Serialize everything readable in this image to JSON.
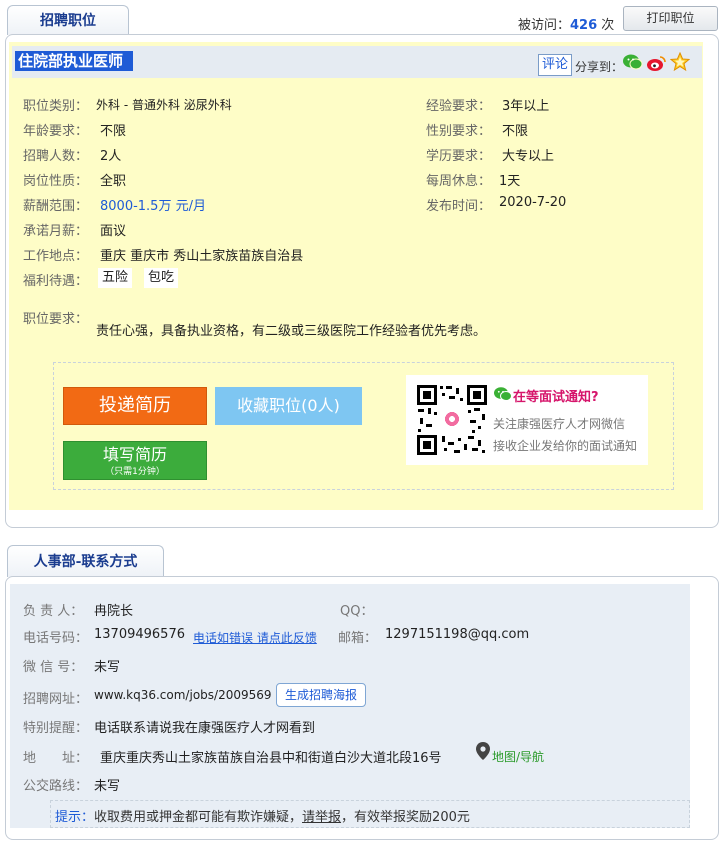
{
  "job_tab": {
    "label": "招聘职位"
  },
  "visits": {
    "prefix": "被访问：",
    "count": "426",
    "suffix": "次"
  },
  "print_button": "打印职位",
  "job": {
    "title": "住院部执业医师",
    "comment_label": "评论",
    "share_label": "分享到：",
    "fields_left": [
      {
        "label": "职位类别：",
        "value": "外科 - 普通外科 泌尿外科"
      },
      {
        "label": "年龄要求：",
        "value": "不限"
      },
      {
        "label": "招聘人数：",
        "value": "2人"
      },
      {
        "label": "岗位性质：",
        "value": "全职"
      },
      {
        "label": "薪酬范围：",
        "value": "8000-1.5万 元/月"
      },
      {
        "label": "承诺月薪：",
        "value": "面议"
      },
      {
        "label": "工作地点：",
        "value": "重庆 重庆市 秀山土家族苗族自治县"
      },
      {
        "label": "福利待遇：",
        "value": ""
      }
    ],
    "fields_right": [
      {
        "label": "经验要求：",
        "value": "3年以上"
      },
      {
        "label": "性别要求：",
        "value": "不限"
      },
      {
        "label": "学历要求：",
        "value": "大专以上"
      },
      {
        "label": "每周休息：",
        "value": "1天"
      },
      {
        "label": "发布时间：",
        "value": "2020-7-20"
      }
    ],
    "benefits": [
      "五险",
      "包吃"
    ],
    "requirement_label": "职位要求：",
    "requirement_text": "责任心强，具备执业资格，有二级或三级医院工作经验者优先考虑。",
    "apply_button": "投递简历",
    "favorite_button": "收藏职位(0人)",
    "fill_resume_button": "填写简历",
    "fill_resume_sub": "（只需1分钟）",
    "interview_title": "在等面试通知?",
    "interview_line1": "关注康强医疗人才网微信",
    "interview_line2": "接收企业发给你的面试通知"
  },
  "contact_tab": {
    "label": "人事部-联系方式"
  },
  "contact": {
    "person_label": "负 责 人：",
    "person_value": "冉院长",
    "qq_label": "QQ：",
    "qq_value": "",
    "phone_label": "电话号码：",
    "phone_value": "13709496576",
    "phone_feedback": "电话如错误 请点此反馈",
    "email_label": "邮箱：",
    "email_value": "1297151198@qq.com",
    "wechat_label": "微 信 号：",
    "wechat_value": "未写",
    "url_label": "招聘网址：",
    "url_value": "www.kq36.com/jobs/2009569",
    "poster_button": "生成招聘海报",
    "notice_label": "特别提醒：",
    "notice_value": "电话联系请说我在康强医疗人才网看到",
    "address_label": "地　　址：",
    "address_value": "重庆重庆秀山土家族苗族自治县中和街道白沙大道北段16号",
    "map_link": "地图/导航",
    "bus_label": "公交路线：",
    "bus_value": "未写",
    "tip_prefix": "提示：",
    "tip_text1": "收取费用或押金都可能有欺诈嫌疑，",
    "tip_link": "请举报",
    "tip_text2": "，有效举报奖励200元"
  },
  "colors": {
    "accent": "#1e5bd6",
    "apply": "#f26a14",
    "favorite": "#7ec6f2",
    "fill": "#3cac3c",
    "highlight": "#fefdc7"
  }
}
